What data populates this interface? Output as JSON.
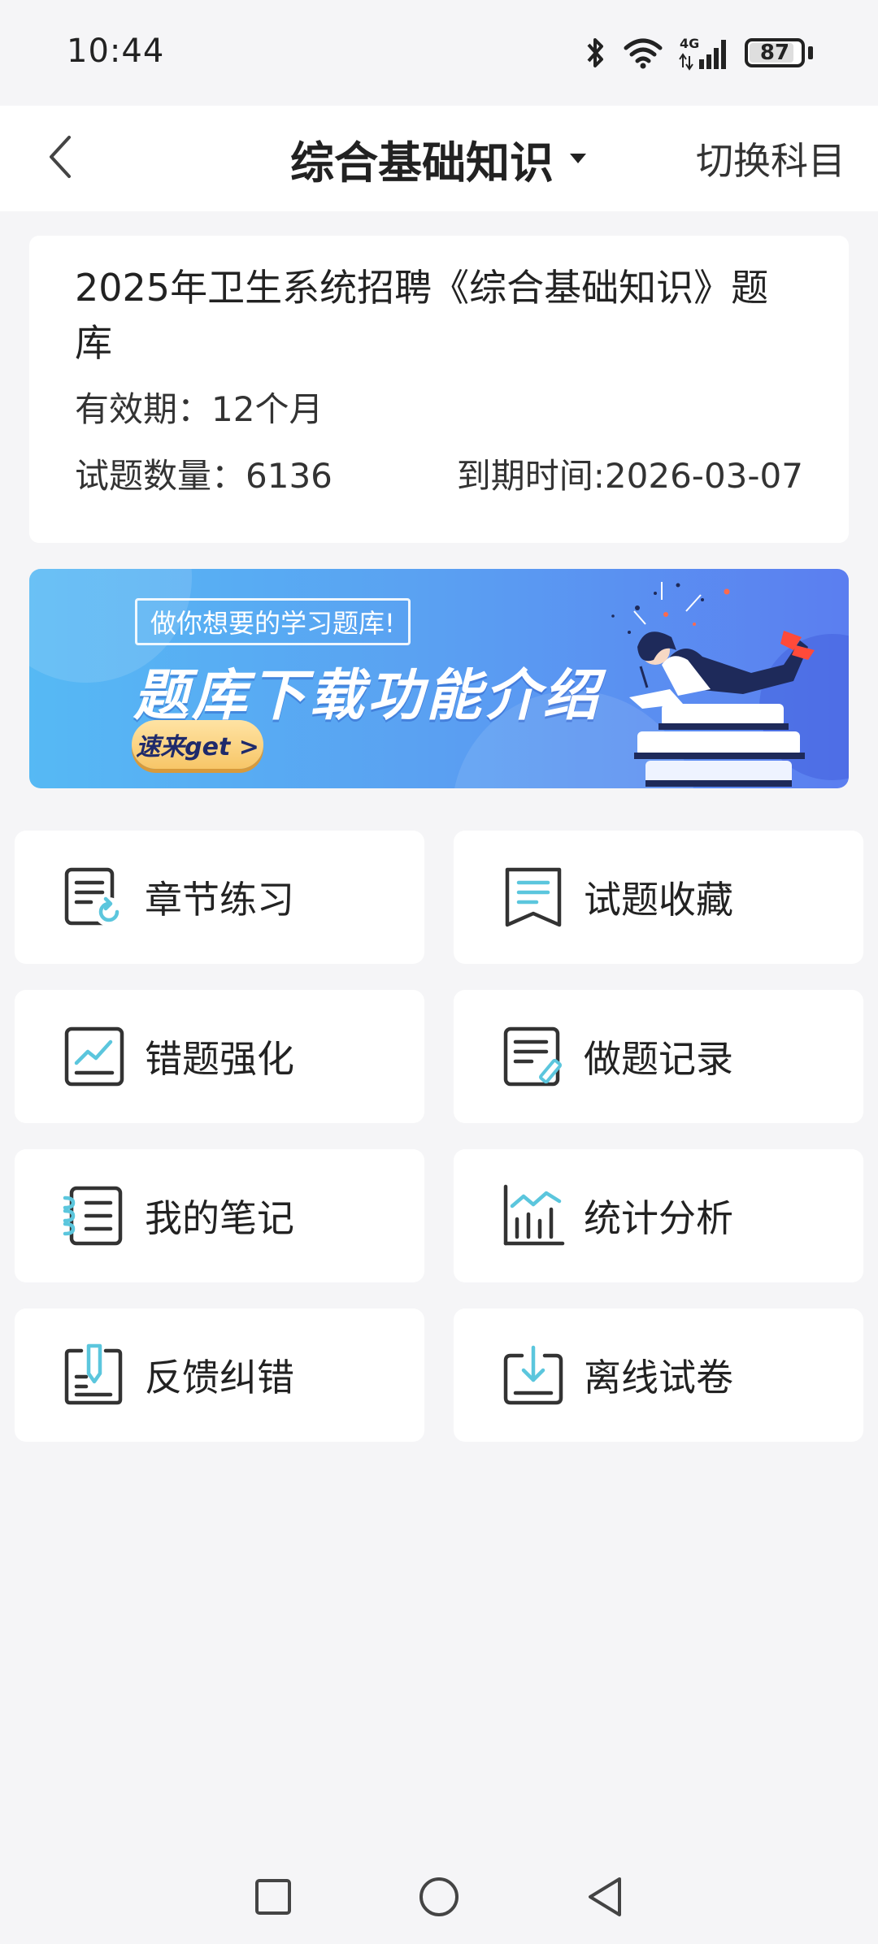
{
  "status_bar": {
    "time": "10:44",
    "battery": "87",
    "network": "4G"
  },
  "header": {
    "back_icon": "chevron-left-icon",
    "title": "综合基础知识",
    "dropdown_icon": "caret-down-icon",
    "switch_label": "切换科目"
  },
  "info_card": {
    "title": "2025年卫生系统招聘《综合基础知识》题库",
    "validity": "有效期：12个月",
    "question_count": "试题数量：6136",
    "expiry": "到期时间:2026-03-07"
  },
  "banner": {
    "tag": "做你想要的学习题库!",
    "headline": "题库下载功能介绍",
    "cta": "速来get >"
  },
  "features": [
    {
      "label": "章节练习",
      "icon": "chapter-practice-icon"
    },
    {
      "label": "试题收藏",
      "icon": "bookmark-icon"
    },
    {
      "label": "错题强化",
      "icon": "wrong-questions-icon"
    },
    {
      "label": "做题记录",
      "icon": "record-edit-icon"
    },
    {
      "label": "我的笔记",
      "icon": "notebook-icon"
    },
    {
      "label": "统计分析",
      "icon": "chart-icon"
    },
    {
      "label": "反馈纠错",
      "icon": "feedback-icon"
    },
    {
      "label": "离线试卷",
      "icon": "download-icon"
    }
  ],
  "colors": {
    "accent": "#5bc6dd",
    "icon_stroke": "#333333",
    "background": "#f5f5f7",
    "banner_start": "#56b9f4",
    "banner_end": "#5b7ef0"
  }
}
